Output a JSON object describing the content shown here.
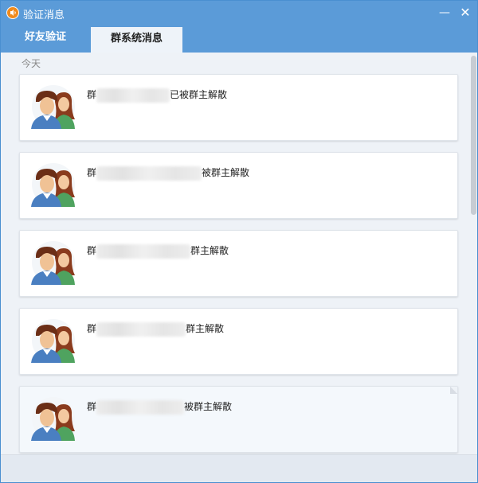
{
  "window": {
    "title": "验证消息"
  },
  "tabs": [
    {
      "label": "好友验证",
      "active": false
    },
    {
      "label": "群系统消息",
      "active": true
    }
  ],
  "day_label": "今天",
  "messages": [
    {
      "prefix": "群",
      "suffix": "已被群主解散",
      "blurred": true
    },
    {
      "prefix": "群",
      "suffix": "被群主解散",
      "blurred": true
    },
    {
      "prefix": "群",
      "suffix": "群主解散",
      "blurred": true
    },
    {
      "prefix": "群",
      "suffix": "群主解散",
      "blurred": true
    },
    {
      "prefix": "群",
      "suffix": "被群主解散",
      "blurred": true
    }
  ],
  "colors": {
    "titlebar": "#5b9bd8",
    "accent": "#f08a1c",
    "background": "#eef2f7"
  },
  "icons": {
    "app": "qq-app-icon",
    "avatar": "couple-avatar-icon"
  }
}
